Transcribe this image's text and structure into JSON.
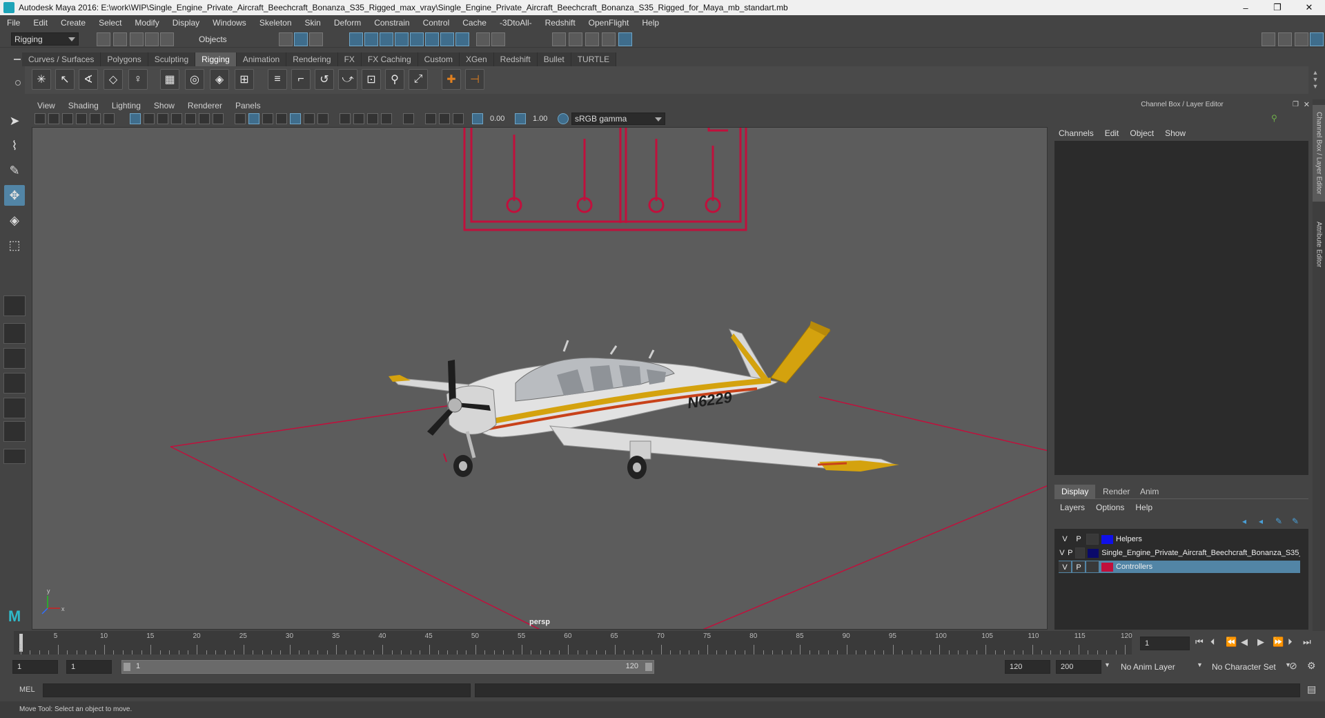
{
  "window": {
    "title": "Autodesk Maya 2016: E:\\work\\WIP\\Single_Engine_Private_Aircraft_Beechcraft_Bonanza_S35_Rigged_max_vray\\Single_Engine_Private_Aircraft_Beechcraft_Bonanza_S35_Rigged_for_Maya_mb_standart.mb",
    "minimize": "–",
    "maximize": "❐",
    "close": "✕"
  },
  "menubar": [
    "File",
    "Edit",
    "Create",
    "Select",
    "Modify",
    "Display",
    "Windows",
    "Skeleton",
    "Skin",
    "Deform",
    "Constrain",
    "Control",
    "Cache",
    "-3DtoAll-",
    "Redshift",
    "OpenFlight",
    "Help"
  ],
  "statusline": {
    "menuset": "Rigging",
    "selection_mode": "Objects"
  },
  "shelf": {
    "tabs": [
      "Curves / Surfaces",
      "Polygons",
      "Sculpting",
      "Rigging",
      "Animation",
      "Rendering",
      "FX",
      "FX Caching",
      "Custom",
      "XGen",
      "Redshift",
      "Bullet",
      "TURTLE"
    ],
    "active_tab": "Rigging"
  },
  "viewport": {
    "menu": [
      "View",
      "Shading",
      "Lighting",
      "Show",
      "Renderer",
      "Panels"
    ],
    "exposure": "0.00",
    "gamma": "1.00",
    "color_space": "sRGB gamma",
    "camera": "persp",
    "aircraft_registration": "N6229",
    "colors": {
      "background": "#5c5c5c",
      "controller": "#c0103c",
      "fuselage": "#e2e2e2",
      "stripe_yellow": "#d4a20e",
      "stripe_red": "#c8421a"
    }
  },
  "right_panel": {
    "title": "Channel Box / Layer Editor",
    "channel_menu": [
      "Channels",
      "Edit",
      "Object",
      "Show"
    ],
    "layer_tabs": [
      "Display",
      "Render",
      "Anim"
    ],
    "active_layer_tab": "Display",
    "layer_menu": [
      "Layers",
      "Options",
      "Help"
    ],
    "layers": [
      {
        "v": "V",
        "p": "P",
        "name": "Helpers",
        "color": "#1010e8",
        "selected": false
      },
      {
        "v": "V",
        "p": "P",
        "name": "Single_Engine_Private_Aircraft_Beechcraft_Bonanza_S35_",
        "color": "#0a0a6a",
        "selected": false
      },
      {
        "v": "V",
        "p": "P",
        "name": "Controllers",
        "color": "#c0103c",
        "selected": true
      }
    ]
  },
  "side_tabs": [
    "Channel Box / Layer Editor",
    "Attribute Editor"
  ],
  "timeline": {
    "start": 1,
    "end": 120,
    "current_frame": "1",
    "tick_labels": [
      "5",
      "10",
      "15",
      "20",
      "25",
      "30",
      "35",
      "40",
      "45",
      "50",
      "55",
      "60",
      "65",
      "70",
      "75",
      "80",
      "85",
      "90",
      "95",
      "100",
      "105",
      "110",
      "115",
      "120"
    ],
    "tick_start_label": "1"
  },
  "range": {
    "start_field": "1",
    "playback_start": "1",
    "range_start_label": "1",
    "range_end_label": "120",
    "playback_end": "120",
    "anim_end": "200",
    "anim_layer": "No Anim Layer",
    "character_set": "No Character Set"
  },
  "command_line": {
    "language": "MEL"
  },
  "help_line": "Move Tool: Select an object to move."
}
